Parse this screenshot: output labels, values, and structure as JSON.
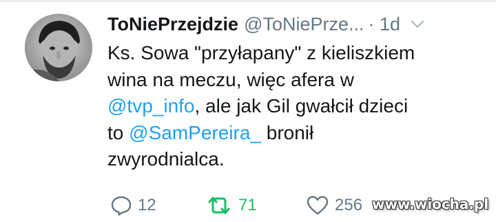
{
  "tweet": {
    "display_name": "ToNiePrzejdzie",
    "handle": "@ToNiePrze...",
    "separator": "·",
    "time": "1d",
    "text_lines": [
      [
        {
          "t": "Ks. Sowa \"przyłapany\" z kieliszkiem",
          "mention": false
        }
      ],
      [
        {
          "t": "wina na meczu, więc afera w",
          "mention": false
        }
      ],
      [
        {
          "t": "@tvp_info",
          "mention": true
        },
        {
          "t": ", ale jak Gil gwałcił dzieci",
          "mention": false
        }
      ],
      [
        {
          "t": "to ",
          "mention": false
        },
        {
          "t": "@SamPereira_",
          "mention": true
        },
        {
          "t": " bronił",
          "mention": false
        }
      ],
      [
        {
          "t": "zwyrodnialca.",
          "mention": false
        }
      ]
    ]
  },
  "actions": {
    "reply_count": "12",
    "retweet_count": "71",
    "like_count": "256"
  },
  "icons": {
    "menu": "chevron-down-icon",
    "reply": "reply-icon",
    "retweet": "retweet-icon",
    "like": "heart-icon"
  },
  "colors": {
    "text": "#14171a",
    "muted": "#657786",
    "link": "#1da1f2",
    "retweet": "#17bf63"
  },
  "watermark": "www.wiocha.pl"
}
